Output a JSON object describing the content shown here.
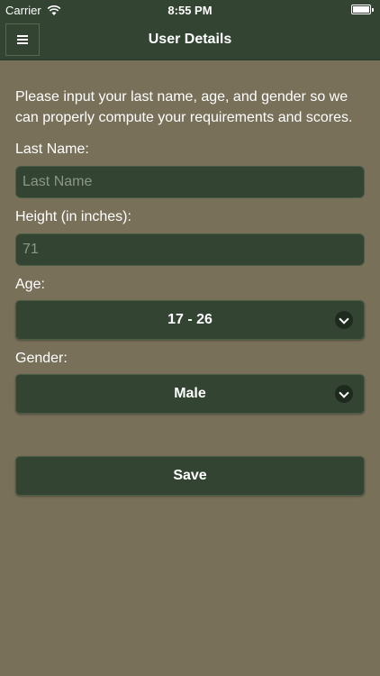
{
  "status_bar": {
    "carrier": "Carrier",
    "time": "8:55 PM",
    "wifi_icon": "wifi-icon",
    "battery_icon": "battery-icon"
  },
  "nav": {
    "title": "User Details",
    "menu_icon": "hamburger-menu-icon"
  },
  "form": {
    "intro": "Please input your last name, age, and gender so we can properly compute your requirements and scores.",
    "last_name": {
      "label": "Last Name:",
      "value": "",
      "placeholder": "Last Name"
    },
    "height": {
      "label": "Height (in inches):",
      "value": "",
      "placeholder": "71"
    },
    "age": {
      "label": "Age:",
      "value": "17 - 26"
    },
    "gender": {
      "label": "Gender:",
      "value": "Male"
    },
    "save_label": "Save"
  },
  "colors": {
    "background": "#79705a",
    "bar": "#334532",
    "field": "#334532",
    "text": "#ffffff"
  }
}
